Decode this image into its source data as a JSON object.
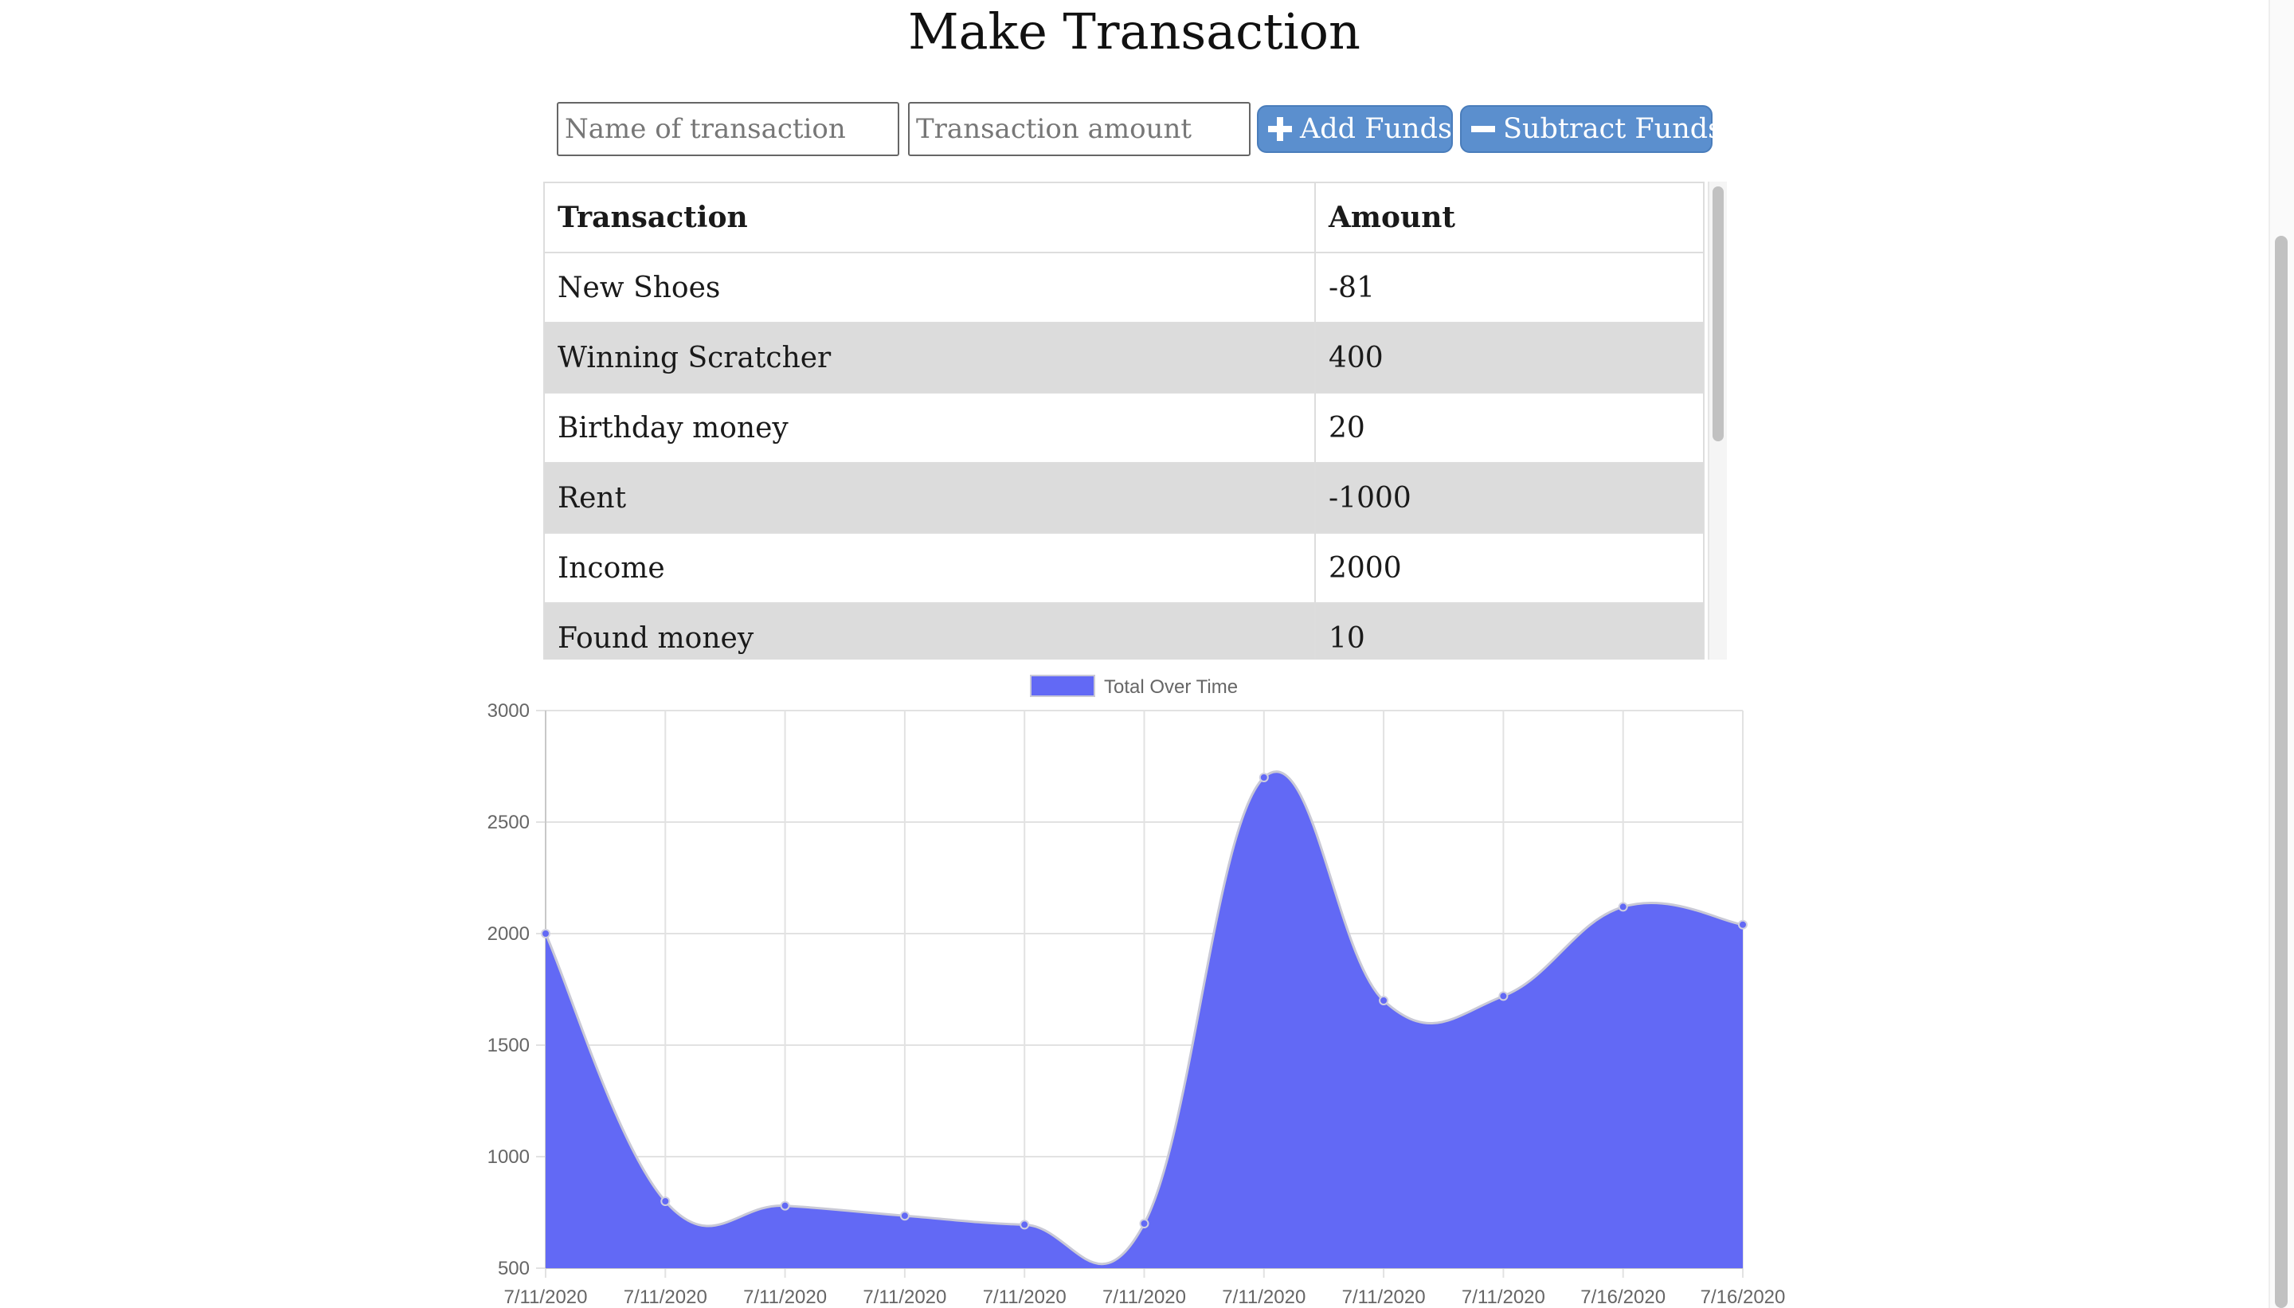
{
  "header": {
    "title": "Make Transaction"
  },
  "form": {
    "name_placeholder": "Name of transaction",
    "amount_placeholder": "Transaction amount",
    "add_label": "Add Funds",
    "subtract_label": "Subtract Funds",
    "add_icon": "plus-icon",
    "subtract_icon": "minus-icon",
    "button_color": "#5b8fce"
  },
  "table": {
    "headers": {
      "name": "Transaction",
      "amount": "Amount"
    },
    "rows": [
      {
        "name": "New Shoes",
        "amount": "-81"
      },
      {
        "name": "Winning Scratcher",
        "amount": "400"
      },
      {
        "name": "Birthday money",
        "amount": "20"
      },
      {
        "name": "Rent",
        "amount": "-1000"
      },
      {
        "name": "Income",
        "amount": "2000"
      },
      {
        "name": "Found money",
        "amount": "10"
      }
    ]
  },
  "chart_data": {
    "type": "area",
    "legend": {
      "position": "top-center"
    },
    "grid": true,
    "x": [
      "7/11/2020",
      "7/11/2020",
      "7/11/2020",
      "7/11/2020",
      "7/11/2020",
      "7/11/2020",
      "7/11/2020",
      "7/11/2020",
      "7/11/2020",
      "7/16/2020",
      "7/16/2020"
    ],
    "series": [
      {
        "name": "Total Over Time",
        "color": "#6269f5",
        "values": [
          2000,
          800,
          780,
          735,
          695,
          700,
          2700,
          1700,
          1720,
          2120,
          2040
        ]
      }
    ],
    "ylim": [
      500,
      3000
    ],
    "yticks": [
      500,
      1000,
      1500,
      2000,
      2500,
      3000
    ]
  }
}
